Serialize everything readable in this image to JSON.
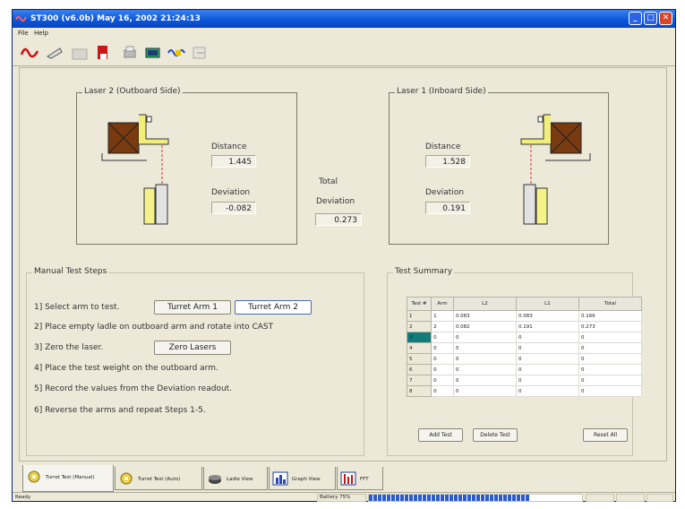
{
  "window": {
    "title": "ST300 (v6.0b) May 16, 2002 21:24:13",
    "menu": [
      "File",
      "Help"
    ],
    "controls": {
      "minimize": "_",
      "maximize": "□",
      "close": "✕"
    }
  },
  "toolbar": {
    "icons": [
      "waveform-icon",
      "probe-icon",
      "folder-icon",
      "save-icon",
      "printer-icon",
      "monitor-icon",
      "signal-icon",
      "export-icon"
    ]
  },
  "laser2": {
    "title": "Laser 2 (Outboard Side)",
    "distance_label": "Distance",
    "distance_value": "1.445",
    "deviation_label": "Deviation",
    "deviation_value": "-0.082"
  },
  "total": {
    "label_line1": "Total",
    "label_line2": "Deviation",
    "value": "0.273"
  },
  "laser1": {
    "title": "Laser 1 (Inboard Side)",
    "distance_label": "Distance",
    "distance_value": "1.528",
    "deviation_label": "Deviation",
    "deviation_value": "0.191"
  },
  "manual": {
    "title": "Manual Test Steps",
    "step1": "1] Select arm to test.",
    "arm1_button": "Turret Arm 1",
    "arm2_button": "Turret Arm 2",
    "step2": "2] Place empty ladle on outboard arm and rotate into CAST",
    "step3": "3] Zero the laser.",
    "zero_button": "Zero Lasers",
    "step4": "4] Place the test weight on the outboard arm.",
    "step5": "5] Record the values from the Deviation readout.",
    "step6": "6] Reverse the arms and repeat Steps 1-5."
  },
  "summary": {
    "title": "Test Summary",
    "columns": [
      "Test #",
      "Arm",
      "L2",
      "L1",
      "Total"
    ],
    "rows": [
      [
        "1",
        "1",
        "0.083",
        "0.083",
        "0.166"
      ],
      [
        "2",
        "2",
        "0.082",
        "0.191",
        "0.273"
      ],
      [
        "3",
        "0",
        "0",
        "0",
        "0"
      ],
      [
        "4",
        "0",
        "0",
        "0",
        "0"
      ],
      [
        "5",
        "0",
        "0",
        "0",
        "0"
      ],
      [
        "6",
        "0",
        "0",
        "0",
        "0"
      ],
      [
        "7",
        "0",
        "0",
        "0",
        "0"
      ],
      [
        "8",
        "0",
        "0",
        "0",
        "0"
      ]
    ],
    "add_button": "Add Test",
    "delete_button": "Delete Test",
    "reset_button": "Reset All"
  },
  "tabs": [
    "Turret Test (Manual)",
    "Turret Test (Auto)",
    "Ladle View",
    "Graph View",
    "FFT"
  ],
  "status": {
    "left": "Ready",
    "battery_label": "Battery 75%",
    "battery_level": 0.75
  },
  "colors": {
    "titlebar": "#0a55d8",
    "selected_row": "#127c7c",
    "block_brown": "#7a3a10",
    "laser_line": "#e03030",
    "battery": "#2a5bd0"
  }
}
